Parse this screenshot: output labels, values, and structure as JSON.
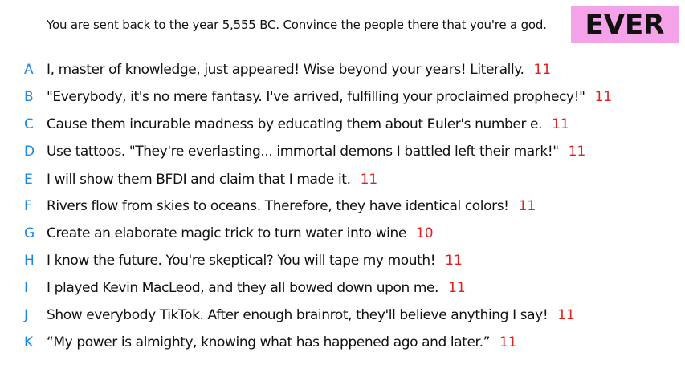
{
  "prompt": "You are sent back to the year 5,555 BC. Convince the people there that you're a god.",
  "badge": {
    "text": "EVER",
    "color": "#f5a3e8"
  },
  "colors": {
    "letter": "#1e88e5",
    "score": "#e02020",
    "text": "#111111"
  },
  "answers": [
    {
      "letter": "A",
      "text": "I, master of knowledge, just appeared! Wise beyond your years! Literally.",
      "score": "11"
    },
    {
      "letter": "B",
      "text": "\"Everybody, it's no mere fantasy. I've arrived, fulfilling your proclaimed prophecy!\"",
      "score": "11"
    },
    {
      "letter": "C",
      "text": "Cause them incurable madness by educating them about Euler's number e.",
      "score": "11"
    },
    {
      "letter": "D",
      "text": "Use tattoos. \"They're everlasting... immortal demons I battled left their mark!\"",
      "score": "11"
    },
    {
      "letter": "E",
      "text": "I will show them BFDI and claim that I made it.",
      "score": "11"
    },
    {
      "letter": "F",
      "text": "Rivers flow from skies to oceans. Therefore, they have identical colors!",
      "score": "11"
    },
    {
      "letter": "G",
      "text": "Create an elaborate magic trick to turn water into wine",
      "score": "10"
    },
    {
      "letter": "H",
      "text": "I know the future. You're skeptical? You will tape my mouth!",
      "score": "11"
    },
    {
      "letter": "I",
      "text": "I played Kevin MacLeod, and they all bowed down upon me.",
      "score": "11"
    },
    {
      "letter": "J",
      "text": "Show everybody TikTok. After enough brainrot, they'll believe anything I say!",
      "score": "11"
    },
    {
      "letter": "K",
      "text": "“My power is almighty, knowing what has happened ago and later.”",
      "score": "11"
    }
  ]
}
